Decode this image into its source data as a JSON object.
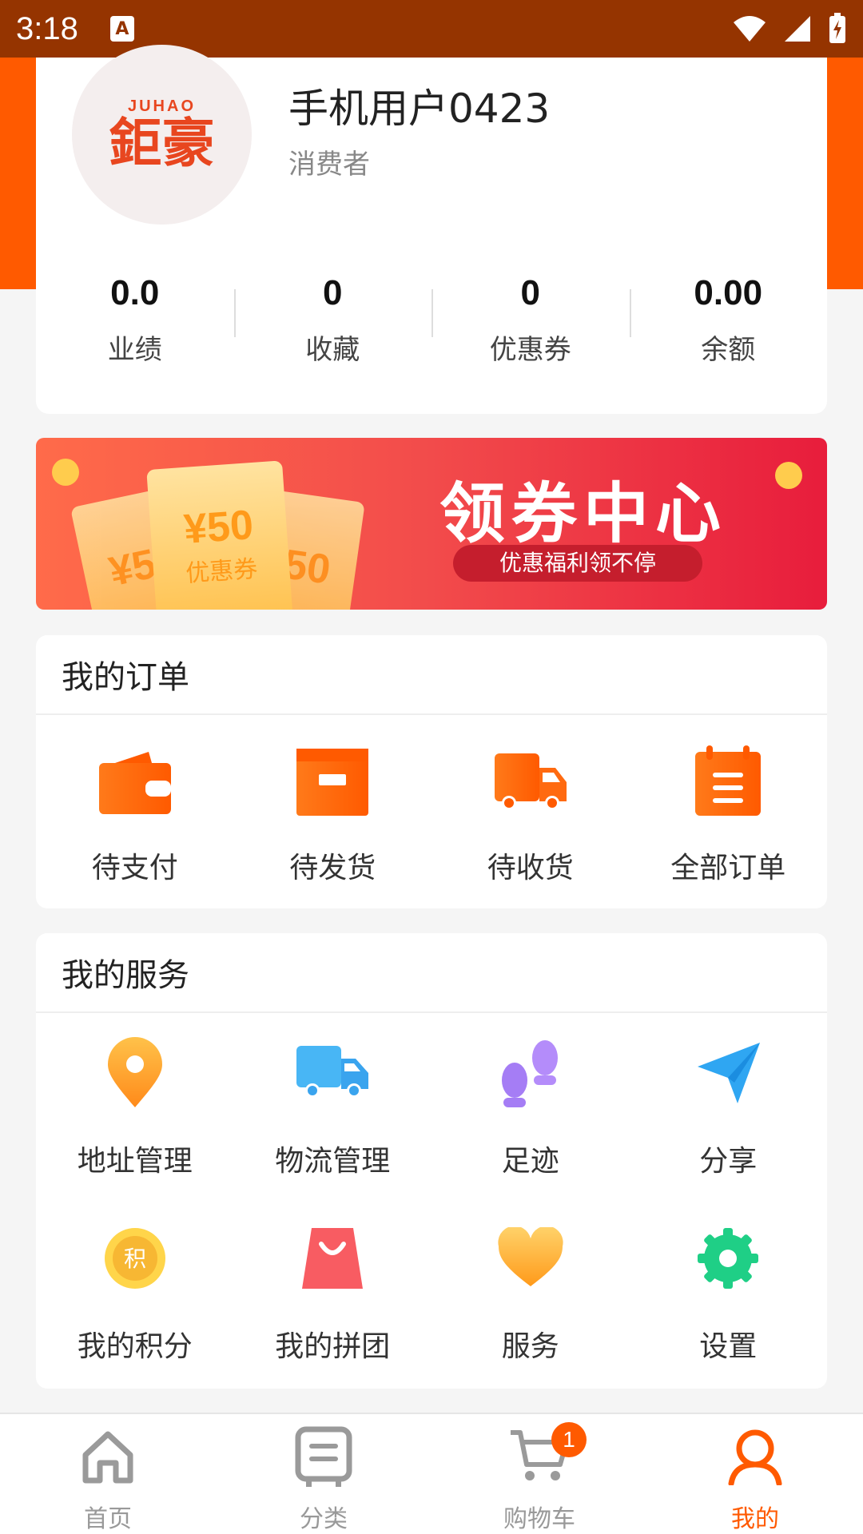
{
  "status_bar": {
    "time": "3:18",
    "notification_glyph": "A"
  },
  "profile": {
    "logo_en": "JUHAO",
    "logo_cn": "鉅豪",
    "username": "手机用户0423",
    "role": "消费者"
  },
  "stats": [
    {
      "value": "0.0",
      "label": "业绩"
    },
    {
      "value": "0",
      "label": "收藏"
    },
    {
      "value": "0",
      "label": "优惠券"
    },
    {
      "value": "0.00",
      "label": "余额"
    }
  ],
  "banner": {
    "title": "领券中心",
    "subtitle": "优惠福利领不停",
    "ticket_amount": "¥50",
    "ticket_label": "优惠券",
    "side_ticket_amount": "¥50"
  },
  "orders": {
    "title": "我的订单",
    "items": [
      {
        "label": "待支付",
        "icon": "wallet-icon"
      },
      {
        "label": "待发货",
        "icon": "box-icon"
      },
      {
        "label": "待收货",
        "icon": "truck-icon"
      },
      {
        "label": "全部订单",
        "icon": "clipboard-icon"
      }
    ]
  },
  "services": {
    "title": "我的服务",
    "items": [
      {
        "label": "地址管理",
        "icon": "location-pin-icon"
      },
      {
        "label": "物流管理",
        "icon": "delivery-truck-icon"
      },
      {
        "label": "足迹",
        "icon": "footprints-icon"
      },
      {
        "label": "分享",
        "icon": "paper-plane-icon"
      },
      {
        "label": "我的积分",
        "icon": "points-coin-icon",
        "glyph": "积"
      },
      {
        "label": "我的拼团",
        "icon": "shopping-bag-icon"
      },
      {
        "label": "服务",
        "icon": "heart-icon"
      },
      {
        "label": "设置",
        "icon": "gear-icon"
      }
    ]
  },
  "bottom_nav": [
    {
      "label": "首页",
      "icon": "home-icon"
    },
    {
      "label": "分类",
      "icon": "category-icon"
    },
    {
      "label": "购物车",
      "icon": "cart-icon",
      "badge": "1"
    },
    {
      "label": "我的",
      "icon": "user-icon",
      "active": true
    }
  ],
  "colors": {
    "primary": "#ff5a00",
    "status_bar": "#953400",
    "inactive": "#999999"
  }
}
